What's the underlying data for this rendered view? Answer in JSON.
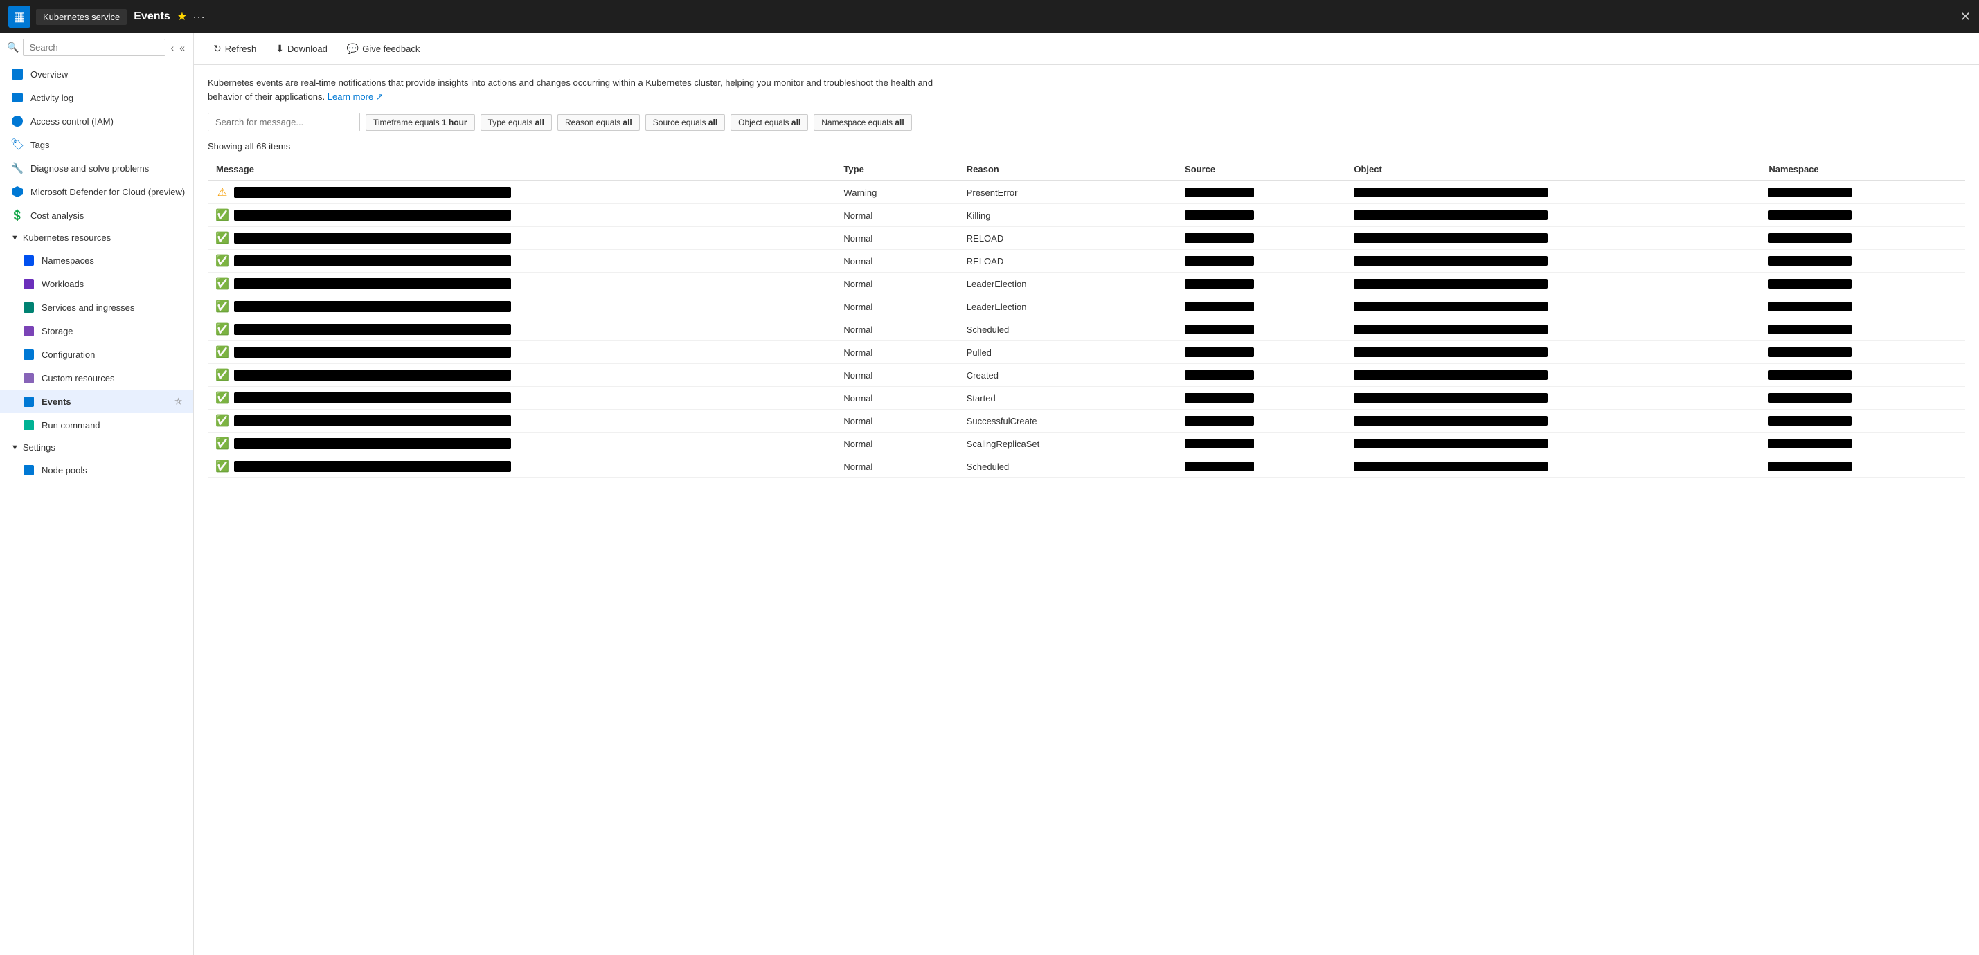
{
  "topBar": {
    "logoText": "▦",
    "serviceName": "Kubernetes service",
    "title": "Events",
    "starLabel": "★",
    "dotsLabel": "···",
    "closeLabel": "✕"
  },
  "sidebar": {
    "searchPlaceholder": "Search",
    "items": [
      {
        "id": "overview",
        "label": "Overview",
        "iconClass": "icon-overview",
        "indent": false
      },
      {
        "id": "activity-log",
        "label": "Activity log",
        "iconClass": "icon-activity",
        "indent": false
      },
      {
        "id": "iam",
        "label": "Access control (IAM)",
        "iconClass": "icon-iam",
        "indent": false
      },
      {
        "id": "tags",
        "label": "Tags",
        "iconClass": "icon-tags",
        "indent": false
      },
      {
        "id": "diagnose",
        "label": "Diagnose and solve problems",
        "iconClass": "icon-diagnose",
        "indent": false
      },
      {
        "id": "defender",
        "label": "Microsoft Defender for Cloud (preview)",
        "iconClass": "icon-defender",
        "indent": false
      },
      {
        "id": "cost-analysis",
        "label": "Cost analysis",
        "iconClass": "icon-cost",
        "indent": false
      }
    ],
    "sections": [
      {
        "id": "kubernetes-resources",
        "label": "Kubernetes resources",
        "expanded": true,
        "children": [
          {
            "id": "namespaces",
            "label": "Namespaces",
            "iconClass": "icon-ns"
          },
          {
            "id": "workloads",
            "label": "Workloads",
            "iconClass": "icon-workloads"
          },
          {
            "id": "services",
            "label": "Services and ingresses",
            "iconClass": "icon-services"
          },
          {
            "id": "storage",
            "label": "Storage",
            "iconClass": "icon-storage"
          },
          {
            "id": "configuration",
            "label": "Configuration",
            "iconClass": "icon-config"
          },
          {
            "id": "custom-resources",
            "label": "Custom resources",
            "iconClass": "icon-custom"
          },
          {
            "id": "events",
            "label": "Events",
            "iconClass": "icon-events",
            "active": true
          },
          {
            "id": "run-command",
            "label": "Run command",
            "iconClass": "icon-run"
          }
        ]
      },
      {
        "id": "settings",
        "label": "Settings",
        "expanded": true,
        "children": [
          {
            "id": "node-pools",
            "label": "Node pools",
            "iconClass": "icon-node"
          }
        ]
      }
    ]
  },
  "toolbar": {
    "refreshLabel": "Refresh",
    "downloadLabel": "Download",
    "feedbackLabel": "Give feedback"
  },
  "content": {
    "descriptionText": "Kubernetes events are real-time notifications that provide insights into actions and changes occurring within a Kubernetes cluster, helping you monitor and troubleshoot the health and behavior of their applications.",
    "learnMoreLabel": "Learn more",
    "searchPlaceholder": "Search for message...",
    "filters": [
      {
        "id": "timeframe",
        "label": "Timeframe equals",
        "value": "1 hour"
      },
      {
        "id": "type",
        "label": "Type equals",
        "value": "all"
      },
      {
        "id": "reason",
        "label": "Reason equals",
        "value": "all"
      },
      {
        "id": "source",
        "label": "Source equals",
        "value": "all"
      },
      {
        "id": "object",
        "label": "Object equals",
        "value": "all"
      },
      {
        "id": "namespace",
        "label": "Namespace equals",
        "value": "all"
      }
    ],
    "itemsCount": "Showing all 68 items",
    "tableHeaders": [
      "Message",
      "Type",
      "Reason",
      "Source",
      "Object",
      "Namespace"
    ],
    "rows": [
      {
        "id": 1,
        "iconType": "warning",
        "type": "Warning",
        "reason": "PresentError",
        "source": "",
        "object": "",
        "namespace": ""
      },
      {
        "id": 2,
        "iconType": "success",
        "type": "Normal",
        "reason": "Killing",
        "source": "",
        "object": "",
        "namespace": ""
      },
      {
        "id": 3,
        "iconType": "success",
        "type": "Normal",
        "reason": "RELOAD",
        "source": "",
        "object": "",
        "namespace": ""
      },
      {
        "id": 4,
        "iconType": "success",
        "type": "Normal",
        "reason": "RELOAD",
        "source": "",
        "object": "",
        "namespace": ""
      },
      {
        "id": 5,
        "iconType": "success",
        "type": "Normal",
        "reason": "LeaderElection",
        "source": "",
        "object": "",
        "namespace": ""
      },
      {
        "id": 6,
        "iconType": "success",
        "type": "Normal",
        "reason": "LeaderElection",
        "source": "",
        "object": "",
        "namespace": ""
      },
      {
        "id": 7,
        "iconType": "success",
        "type": "Normal",
        "reason": "Scheduled",
        "source": "",
        "object": "",
        "namespace": ""
      },
      {
        "id": 8,
        "iconType": "success",
        "type": "Normal",
        "reason": "Pulled",
        "source": "",
        "object": "",
        "namespace": ""
      },
      {
        "id": 9,
        "iconType": "success",
        "type": "Normal",
        "reason": "Created",
        "source": "",
        "object": "",
        "namespace": ""
      },
      {
        "id": 10,
        "iconType": "success",
        "type": "Normal",
        "reason": "Started",
        "source": "",
        "object": "",
        "namespace": ""
      },
      {
        "id": 11,
        "iconType": "success",
        "type": "Normal",
        "reason": "SuccessfulCreate",
        "source": "",
        "object": "",
        "namespace": ""
      },
      {
        "id": 12,
        "iconType": "success",
        "type": "Normal",
        "reason": "ScalingReplicaSet",
        "source": "",
        "object": "",
        "namespace": ""
      },
      {
        "id": 13,
        "iconType": "success",
        "type": "Normal",
        "reason": "Scheduled",
        "source": "",
        "object": "",
        "namespace": ""
      }
    ]
  }
}
